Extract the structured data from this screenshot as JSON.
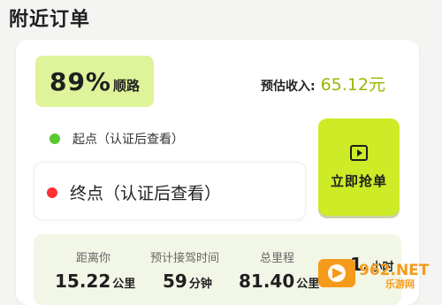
{
  "page": {
    "title": "附近订单"
  },
  "order": {
    "match_percent": "89%",
    "match_label": "顺路",
    "income_label": "预估收入:",
    "income_value": "65.12元",
    "start_text": "起点（认证后查看）",
    "end_text": "终点（认证后查看）",
    "grab_label": "立即抢单",
    "stats": [
      {
        "label": "距离你",
        "value": "15.22",
        "unit": "公里"
      },
      {
        "label": "预计接驾时间",
        "value": "59",
        "unit": "分钟"
      },
      {
        "label": "总里程",
        "value": "81.40",
        "unit": "公里"
      },
      {
        "label": "",
        "value": "1.",
        "unit": "小时"
      }
    ]
  },
  "icons": {
    "start_dot": "green-dot-icon",
    "end_dot": "red-dot-icon",
    "grab_icon": "play-icon"
  },
  "colors": {
    "accent": "#cdeb26",
    "badge": "#dff39a",
    "income": "#96b800",
    "start_dot": "#58c92f",
    "end_dot": "#ff2f35"
  },
  "watermark": {
    "text": "962.NET",
    "subtext": "乐游网"
  }
}
